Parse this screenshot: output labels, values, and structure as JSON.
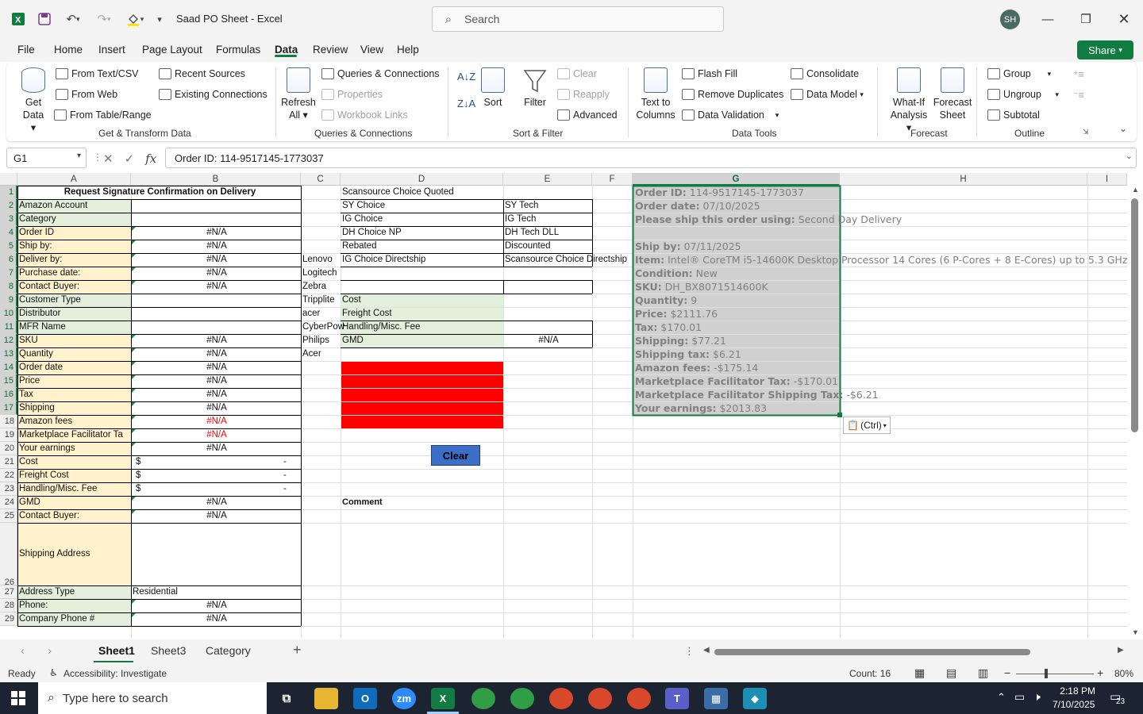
{
  "app": {
    "title": "Saad PO Sheet  -  Excel",
    "search_placeholder": "Search",
    "avatar_initials": "SH",
    "accent": "#107c41"
  },
  "menu": {
    "items": [
      "File",
      "Home",
      "Insert",
      "Page Layout",
      "Formulas",
      "Data",
      "Review",
      "View",
      "Help"
    ],
    "active": "Data",
    "share": "Share"
  },
  "ribbon": {
    "get_data": [
      "Get",
      "Data"
    ],
    "from_text_csv": "From Text/CSV",
    "from_web": "From Web",
    "from_table_range": "From Table/Range",
    "recent_sources": "Recent Sources",
    "existing_connections": "Existing Connections",
    "group_get_transform": "Get & Transform Data",
    "refresh_all": [
      "Refresh",
      "All"
    ],
    "queries_connections": "Queries & Connections",
    "properties": "Properties",
    "workbook_links": "Workbook Links",
    "group_queries": "Queries & Connections",
    "sort": "Sort",
    "filter": "Filter",
    "clear": "Clear",
    "reapply": "Reapply",
    "advanced": "Advanced",
    "group_sort_filter": "Sort & Filter",
    "text_to_columns": [
      "Text to",
      "Columns"
    ],
    "flash_fill": "Flash Fill",
    "remove_duplicates": "Remove Duplicates",
    "data_validation": "Data Validation",
    "consolidate": "Consolidate",
    "data_model": "Data Model",
    "group_data_tools": "Data Tools",
    "what_if": [
      "What-If",
      "Analysis"
    ],
    "forecast_sheet": [
      "Forecast",
      "Sheet"
    ],
    "group_forecast": "Forecast",
    "group": "Group",
    "ungroup": "Ungroup",
    "subtotal": "Subtotal",
    "group_outline": "Outline"
  },
  "formula_bar": {
    "name_box": "G1",
    "content": "Order ID: 114-9517145-1773037"
  },
  "columns": [
    "A",
    "B",
    "C",
    "D",
    "E",
    "F",
    "G",
    "H",
    "I"
  ],
  "rows": [
    "1",
    "2",
    "3",
    "4",
    "5",
    "6",
    "7",
    "8",
    "9",
    "10",
    "11",
    "12",
    "13",
    "14",
    "15",
    "16",
    "17",
    "18",
    "19",
    "20",
    "21",
    "22",
    "23",
    "24",
    "25",
    "26",
    "27",
    "28",
    "29"
  ],
  "sheet": {
    "a_labels": [
      "Request Signature Confirmation on Delivery",
      "Amazon Account",
      "Category",
      "Order ID",
      "Ship by:",
      "Deliver by:",
      "Purchase date:",
      "Contact Buyer:",
      "Customer Type",
      "Distributor",
      "MFR Name",
      "SKU",
      "Quantity",
      "Order date",
      "Price",
      "Tax",
      "Shipping",
      "Amazon fees",
      "Marketplace Facilitator Ta",
      "Your earnings",
      "Cost",
      "Freight Cost",
      "Handling/Misc. Fee",
      "GMD",
      "Contact Buyer:",
      "Shipping Address",
      "Address Type",
      "Phone:",
      "Company Phone #"
    ],
    "b_values": [
      "",
      "",
      "",
      "#N/A",
      "#N/A",
      "#N/A",
      "#N/A",
      "#N/A",
      "",
      "",
      "",
      "#N/A",
      "#N/A",
      "#N/A",
      "#N/A",
      "#N/A",
      "#N/A",
      "#N/A",
      "#N/A",
      "#N/A",
      "",
      "",
      "",
      "#N/A",
      "#N/A",
      "",
      "Residential",
      "#N/A",
      "#N/A"
    ],
    "dollar": "$",
    "dash": "-",
    "c_values": [
      "Lenovo",
      "Logitech",
      "Zebra",
      "Tripplite",
      "acer",
      "CyberPow",
      "Philips",
      "Acer"
    ],
    "d_values": [
      "Scansource Choice Quoted",
      "SY Choice",
      "IG Choice",
      "DH Choice NP",
      " Rebated",
      "IG Choice Directship",
      "",
      "",
      "Cost",
      "Freight Cost",
      "Handling/Misc. Fee",
      "GMD"
    ],
    "e_values": [
      "SY Tech",
      "IG Tech",
      "DH Tech DLL",
      " Discounted",
      "Scansource Choice Directship"
    ],
    "e12": "#N/A",
    "clear_button": "Clear",
    "comment": "Comment",
    "paste_options": "(Ctrl)",
    "g_lines": [
      {
        "k": "Order ID:",
        "v": " 114-9517145-1773037"
      },
      {
        "k": "Order date:",
        "v": " 07/10/2025"
      },
      {
        "k": "Please ship this order using:",
        "v": " Second Day Delivery"
      },
      {
        "k": "",
        "v": ""
      },
      {
        "k": "Ship by:",
        "v": " 07/11/2025"
      },
      {
        "k": "Item:",
        "v": " Intel® CoreTM i5-14600K Desktop Processor 14 Cores (6 P-Cores + 8 E-Cores) up to 5.3 GHz"
      },
      {
        "k": "Condition:",
        "v": " New"
      },
      {
        "k": "SKU:",
        "v": " DH_BX8071514600K"
      },
      {
        "k": "Quantity:",
        "v": " 9"
      },
      {
        "k": "Price:",
        "v": " $2111.76"
      },
      {
        "k": "Tax:",
        "v": " $170.01"
      },
      {
        "k": "Shipping:",
        "v": " $77.21"
      },
      {
        "k": "Shipping tax:",
        "v": " $6.21"
      },
      {
        "k": "Amazon fees:",
        "v": " -$175.14"
      },
      {
        "k": "Marketplace Facilitator Tax:",
        "v": " -$170.01"
      },
      {
        "k": "Marketplace Facilitator Shipping Tax:",
        "v": " -$6.21"
      },
      {
        "k": "Your earnings:",
        "v": " $2013.83"
      }
    ]
  },
  "sheet_tabs": [
    "Sheet1",
    "Sheet3",
    "Category"
  ],
  "status": {
    "ready": "Ready",
    "accessibility": "Accessibility: Investigate",
    "count": "Count: 16",
    "zoom": "80%"
  },
  "taskbar": {
    "search_placeholder": "Type here to search",
    "time": "2:18 PM",
    "date": "7/10/2025",
    "notif_count": "23"
  }
}
